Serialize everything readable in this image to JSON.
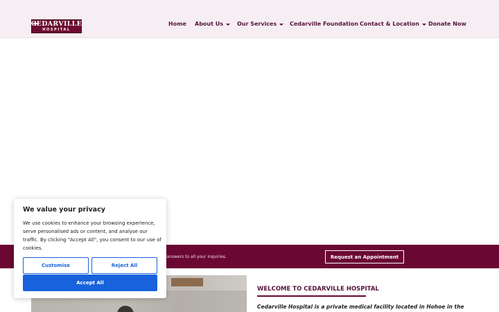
{
  "header": {
    "logo": {
      "line1": "CEDARVILLE",
      "line2": "HOSPITAL"
    },
    "nav": [
      {
        "label": "Home",
        "dropdown": false
      },
      {
        "label": "About Us",
        "dropdown": true
      },
      {
        "label": "Our Services",
        "dropdown": true
      },
      {
        "label": "Cedarville Foundation",
        "dropdown": false
      },
      {
        "label": "Contact & Location",
        "dropdown": true
      },
      {
        "label": "Donate Now",
        "dropdown": false
      }
    ]
  },
  "banner": {
    "text": "r answers to all your inquiries.",
    "button_label": "Request an Appointment"
  },
  "main": {
    "welcome_heading": "WELCOME TO CEDARVILLE HOSPITAL",
    "intro_text": "Cedarville Hospital is a private medical facility located in Hohoe in the"
  },
  "cookie": {
    "title": "We value your privacy",
    "body": "We use cookies to enhance your browsing experience, serve personalised ads or content, and analyse our traffic. By clicking \"Accept All\", you consent to our use of cookies.",
    "customise_label": "Customise",
    "reject_label": "Reject All",
    "accept_label": "Accept All"
  },
  "colors": {
    "brand": "#6b0733",
    "nav_text": "#55143a",
    "header_bg": "#f6eef3",
    "cookie_button": "#1863dc"
  }
}
